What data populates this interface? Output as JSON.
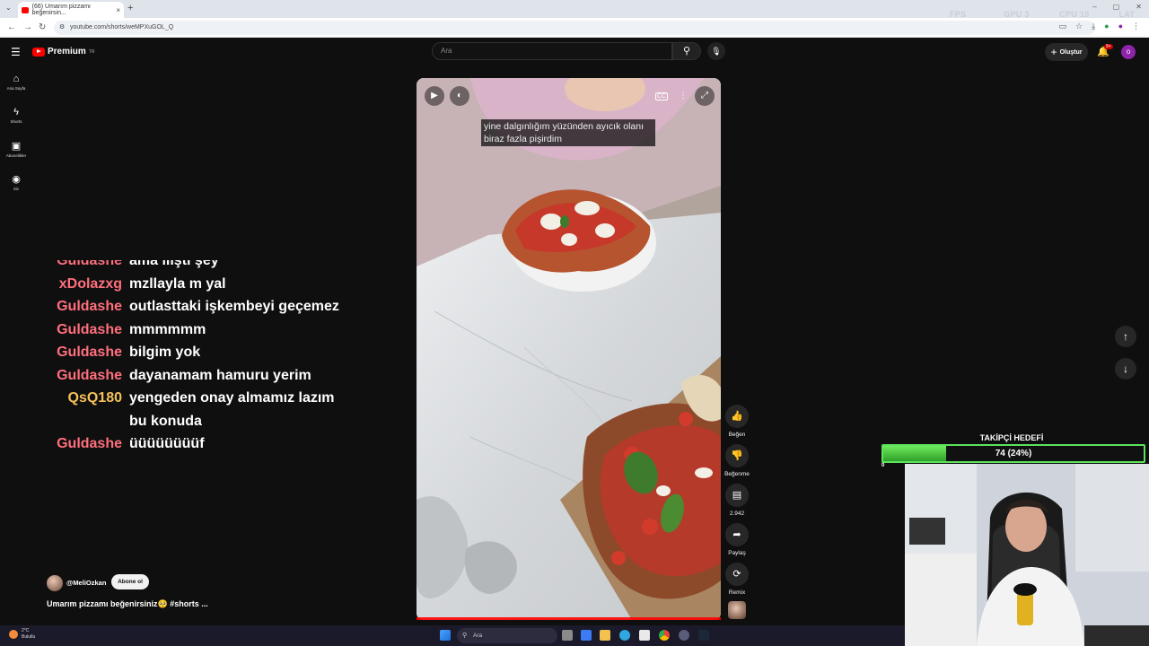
{
  "browser": {
    "tab_title": "(66) Umarım pizzamı beğenirsin...",
    "url": "youtube.com/shorts/weMPXuGOL_Q",
    "hud": {
      "fps": "FPS N/A",
      "gpu": "GPU 3 %",
      "cpu": "CPU 10 %",
      "lat": "LAT N/A"
    }
  },
  "yt": {
    "logo_text": "Premium",
    "logo_region": "TR",
    "search_placeholder": "Ara",
    "create_label": "Oluştur",
    "notif_count": "9+",
    "avatar_letter": "o"
  },
  "guide": [
    {
      "label": "Ana Sayfa",
      "icon": "home-icon"
    },
    {
      "label": "Shorts",
      "icon": "shorts-icon"
    },
    {
      "label": "Abonelikler",
      "icon": "subscriptions-icon"
    },
    {
      "label": "Siz",
      "icon": "you-icon"
    }
  ],
  "chat": [
    {
      "user": "Guldashe",
      "text": "ama ılıştı şey",
      "color": "#ff6f7d"
    },
    {
      "user": "xDolazxg",
      "text": "mzllayla m yal",
      "color": "#ff6f7d"
    },
    {
      "user": "Guldashe",
      "text": "outlasttaki işkembeyi geçemez",
      "color": "#ff6f7d"
    },
    {
      "user": "Guldashe",
      "text": "mmmmmm",
      "color": "#ff6f7d"
    },
    {
      "user": "Guldashe",
      "text": "bilgim yok",
      "color": "#ff6f7d"
    },
    {
      "user": "Guldashe",
      "text": "dayanamam hamuru yerim",
      "color": "#ff6f7d"
    },
    {
      "user": "QsQ180",
      "text": "yengeden onay almamız lazım bu konuda",
      "color": "#f5c05a"
    },
    {
      "user": "Guldashe",
      "text": "üüüüüüüüf",
      "color": "#ff6f7d"
    }
  ],
  "video": {
    "caption": "yine dalgınlığım yüzünden ayıcık olanı biraz fazla pişirdim",
    "channel": "@MeliOzkan",
    "subscribe_label": "Abone ol",
    "title": "Umarım pizzamı beğenirsiniz🥺 #shorts ...",
    "progress": 1.0
  },
  "actions": {
    "like": "Beğen",
    "dislike": "Beğenme",
    "comments": "2.942",
    "share": "Paylaş",
    "remix": "Remix"
  },
  "goal": {
    "title": "TAKİPÇİ HEDEFİ",
    "value_text": "74 (24%)",
    "fraction": 0.24,
    "min": "0"
  },
  "taskbar": {
    "temp": "2°C",
    "weather": "Bulutlu",
    "search": "Ara"
  }
}
